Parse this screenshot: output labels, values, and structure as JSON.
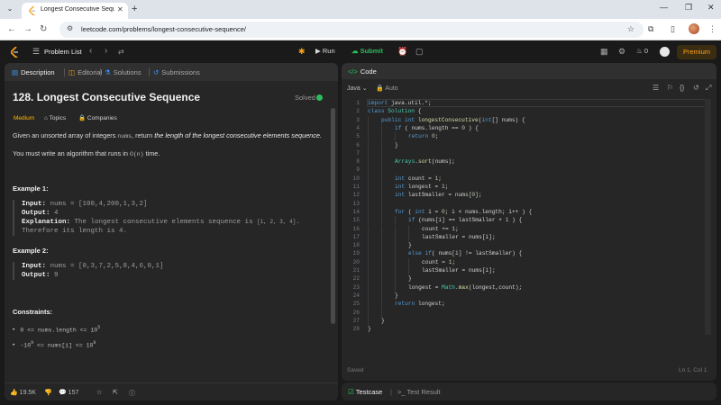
{
  "browser": {
    "tab_title": "Longest Consecutive Sequence",
    "url": "leetcode.com/problems/longest-consecutive-sequence/"
  },
  "topbar": {
    "problem_list": "Problem List",
    "run": "Run",
    "submit": "Submit",
    "fire_count": "0",
    "premium": "Premium"
  },
  "left_tabs": {
    "description": "Description",
    "editorial": "Editorial",
    "solutions": "Solutions",
    "submissions": "Submissions"
  },
  "problem": {
    "title": "128. Longest Consecutive Sequence",
    "status": "Solved",
    "difficulty": "Medium",
    "topics_label": "Topics",
    "companies_label": "Companies",
    "desc_1a": "Given an unsorted array of integers ",
    "desc_1_code": "nums",
    "desc_1b": ", return ",
    "desc_1_em": "the length of the longest consecutive elements sequence.",
    "desc_2a": "You must write an algorithm that runs in ",
    "desc_2_code": "O(n)",
    "desc_2b": " time.",
    "examples": [
      {
        "title": "Example 1:",
        "input_label": "Input:",
        "input": "nums = [100,4,200,1,3,2]",
        "output_label": "Output:",
        "output": "4",
        "explanation_label": "Explanation:",
        "explanation": "The longest consecutive elements sequence is",
        "explanation_code": "[1, 2, 3, 4]",
        "explanation_tail": ".",
        "explanation_2": "Therefore its length is 4."
      },
      {
        "title": "Example 2:",
        "input_label": "Input:",
        "input": "nums = [0,3,7,2,5,8,4,6,0,1]",
        "output_label": "Output:",
        "output": "9"
      }
    ],
    "constraints_title": "Constraints:",
    "constraint_1": "0 <= nums.length <= 10",
    "constraint_1_sup": "5",
    "constraint_2a": "-10",
    "constraint_2a_sup": "9",
    "constraint_2b": " <= nums[i] <= 10",
    "constraint_2b_sup": "9"
  },
  "footer": {
    "likes": "19.5K",
    "comments": "157"
  },
  "editor": {
    "tab_label": "Code",
    "language": "Java",
    "auto": "Auto",
    "saved": "Saved",
    "cursor": "Ln 1, Col 1",
    "line_numbers": [
      "1",
      "2",
      "3",
      "4",
      "5",
      "6",
      "7",
      "8",
      "9",
      "10",
      "11",
      "12",
      "13",
      "14",
      "15",
      "16",
      "17",
      "18",
      "19",
      "20",
      "21",
      "22",
      "23",
      "24",
      "25",
      "26",
      "27",
      "28"
    ]
  },
  "bottom": {
    "testcase": "Testcase",
    "test_result": "Test Result"
  },
  "colors": {
    "accent_green": "#2cbb5d",
    "medium": "#ffb800",
    "premium": "#ffa116",
    "link_blue": "#3c9aff"
  }
}
